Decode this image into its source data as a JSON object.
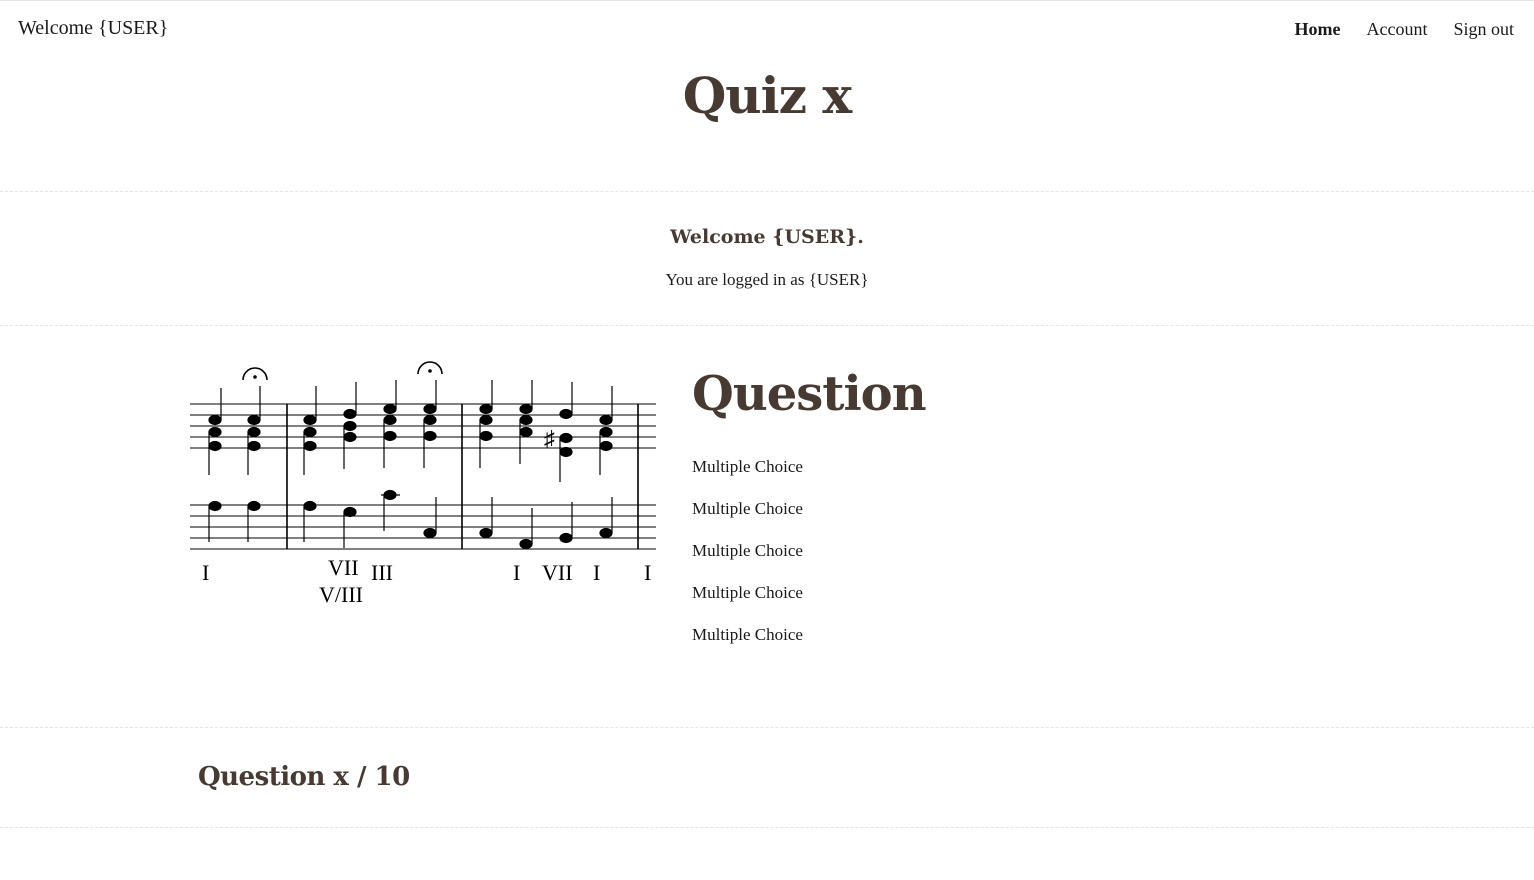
{
  "header": {
    "brand": "Welcome {USER}",
    "nav": [
      {
        "label": "Home",
        "active": true
      },
      {
        "label": "Account",
        "active": false
      },
      {
        "label": "Sign out",
        "active": false
      }
    ]
  },
  "page": {
    "title": "Quiz x"
  },
  "welcome": {
    "heading": "Welcome {USER}.",
    "logged_in_text": "You are logged in as {USER}"
  },
  "question": {
    "title": "Question",
    "choices": [
      "Multiple Choice",
      "Multiple Choice",
      "Multiple Choice",
      "Multiple Choice",
      "Multiple Choice"
    ]
  },
  "score": {
    "roman_numerals": [
      "I",
      "VII",
      "III",
      "I",
      "VII",
      "I",
      "I"
    ],
    "roman_lower": "V/III"
  },
  "progress": {
    "text": "Question x / 10"
  },
  "colors": {
    "heading": "#463a33",
    "text": "#1a1a1a"
  }
}
